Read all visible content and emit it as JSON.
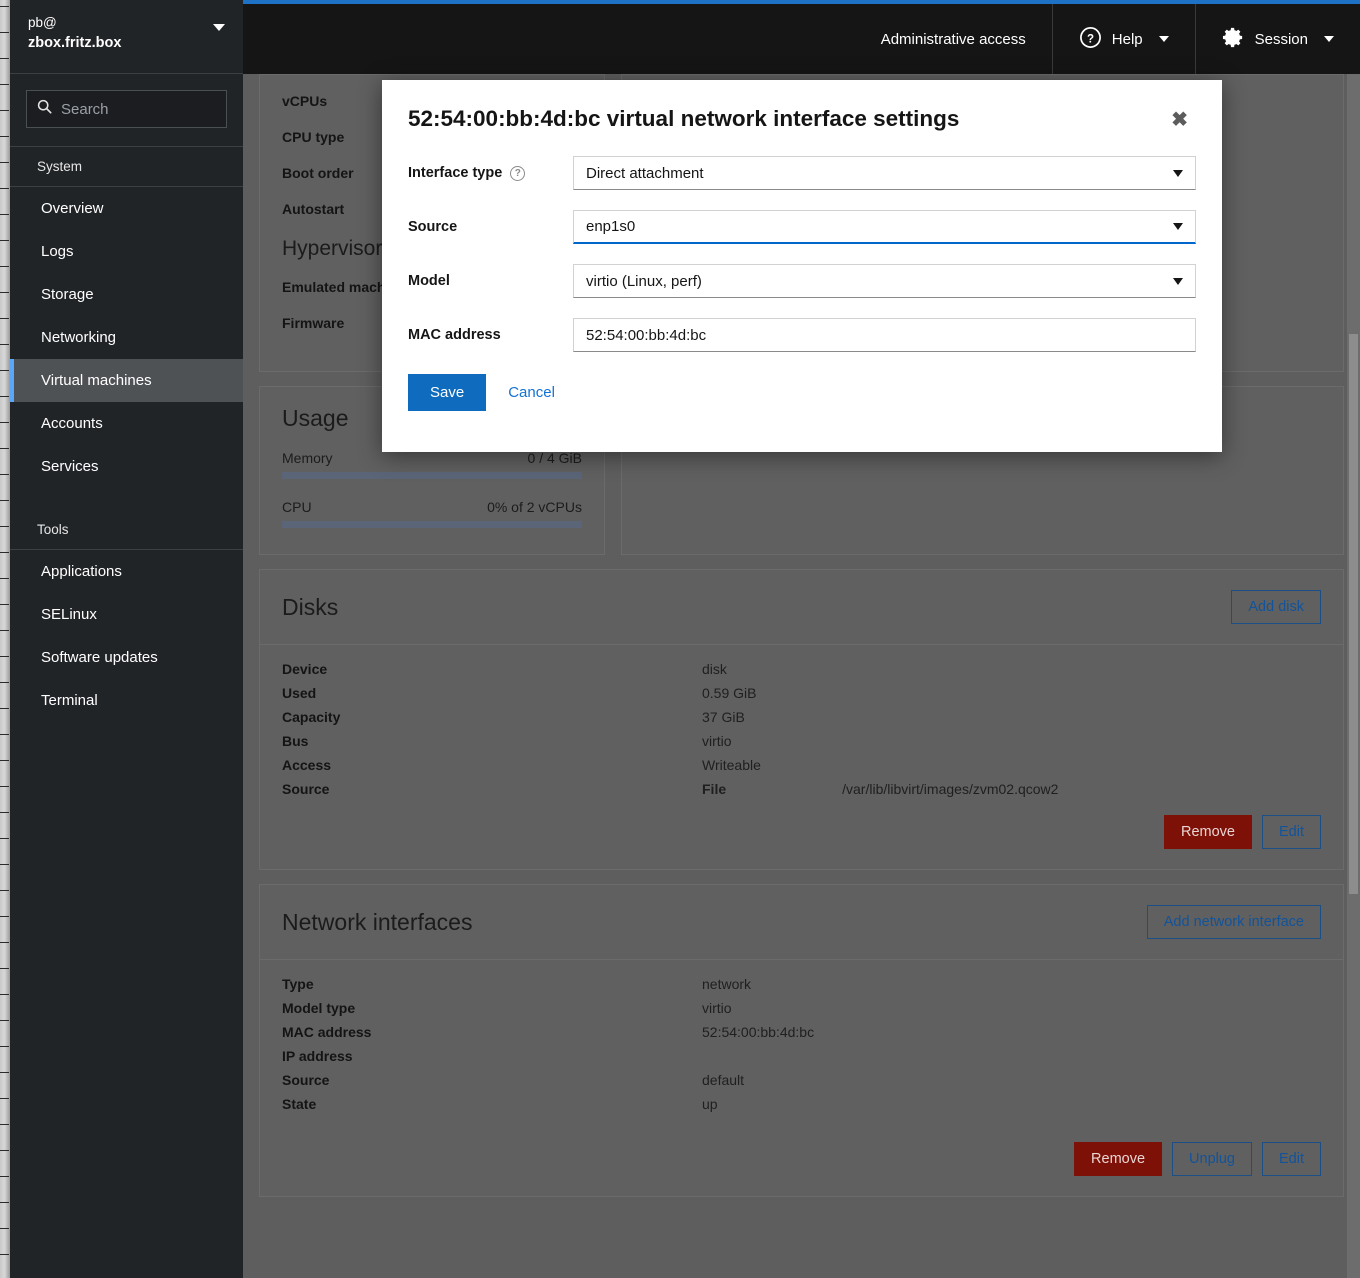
{
  "sidebar": {
    "user": "pb@",
    "host": "zbox.fritz.box",
    "search_placeholder": "Search",
    "groups": [
      {
        "label": "System",
        "items": [
          "Overview",
          "Logs",
          "Storage",
          "Networking",
          "Virtual machines",
          "Accounts",
          "Services"
        ]
      },
      {
        "label": "Tools",
        "items": [
          "Applications",
          "SELinux",
          "Software updates",
          "Terminal"
        ]
      }
    ],
    "active_item": "Virtual machines"
  },
  "topnav": {
    "admin_access": "Administrative access",
    "help": "Help",
    "session": "Session"
  },
  "overview_card": {
    "rows": [
      "vCPUs",
      "CPU type",
      "Boot order",
      "Autostart"
    ],
    "subheading": "Hypervisor details",
    "sub_rows": [
      "Emulated machine",
      "Firmware"
    ]
  },
  "usage_card": {
    "title": "Usage",
    "memory_label": "Memory",
    "memory_value": "0 / 4 GiB",
    "cpu_label": "CPU",
    "cpu_value": "0% of 2 vCPUs",
    "memory_percent": 0,
    "cpu_percent": 0
  },
  "disks_card": {
    "title": "Disks",
    "add_label": "Add disk",
    "rows": [
      {
        "key": "Device",
        "value": "disk"
      },
      {
        "key": "Used",
        "value": "0.59 GiB"
      },
      {
        "key": "Capacity",
        "value": "37 GiB"
      },
      {
        "key": "Bus",
        "value": "virtio"
      },
      {
        "key": "Access",
        "value": "Writeable"
      }
    ],
    "source_key": "Source",
    "source_value": "File",
    "source_path": "/var/lib/libvirt/images/zvm02.qcow2",
    "remove_label": "Remove",
    "edit_label": "Edit"
  },
  "network_card": {
    "title": "Network interfaces",
    "add_label": "Add network interface",
    "rows": [
      {
        "key": "Type",
        "value": "network"
      },
      {
        "key": "Model type",
        "value": "virtio"
      },
      {
        "key": "MAC address",
        "value": "52:54:00:bb:4d:bc"
      },
      {
        "key": "IP address",
        "value": ""
      },
      {
        "key": "Source",
        "value": "default"
      },
      {
        "key": "State",
        "value": "up"
      }
    ],
    "remove_label": "Remove",
    "unplug_label": "Unplug",
    "edit_label": "Edit"
  },
  "modal": {
    "title": "52:54:00:bb:4d:bc virtual network interface settings",
    "close_glyph": "✖",
    "interface_type_label": "Interface type",
    "interface_type_value": "Direct attachment",
    "help_glyph": "?",
    "source_label": "Source",
    "source_value": "enp1s0",
    "model_label": "Model",
    "model_value": "virtio (Linux, perf)",
    "mac_label": "MAC address",
    "mac_value": "52:54:00:bb:4d:bc",
    "save_label": "Save",
    "cancel_label": "Cancel"
  },
  "colors": {
    "accent_blue": "#1e72c6",
    "primary_button": "#0f6bbd",
    "danger": "#7d1007",
    "sidebar_bg": "#212427",
    "active_marker": "#5ba7f7"
  }
}
